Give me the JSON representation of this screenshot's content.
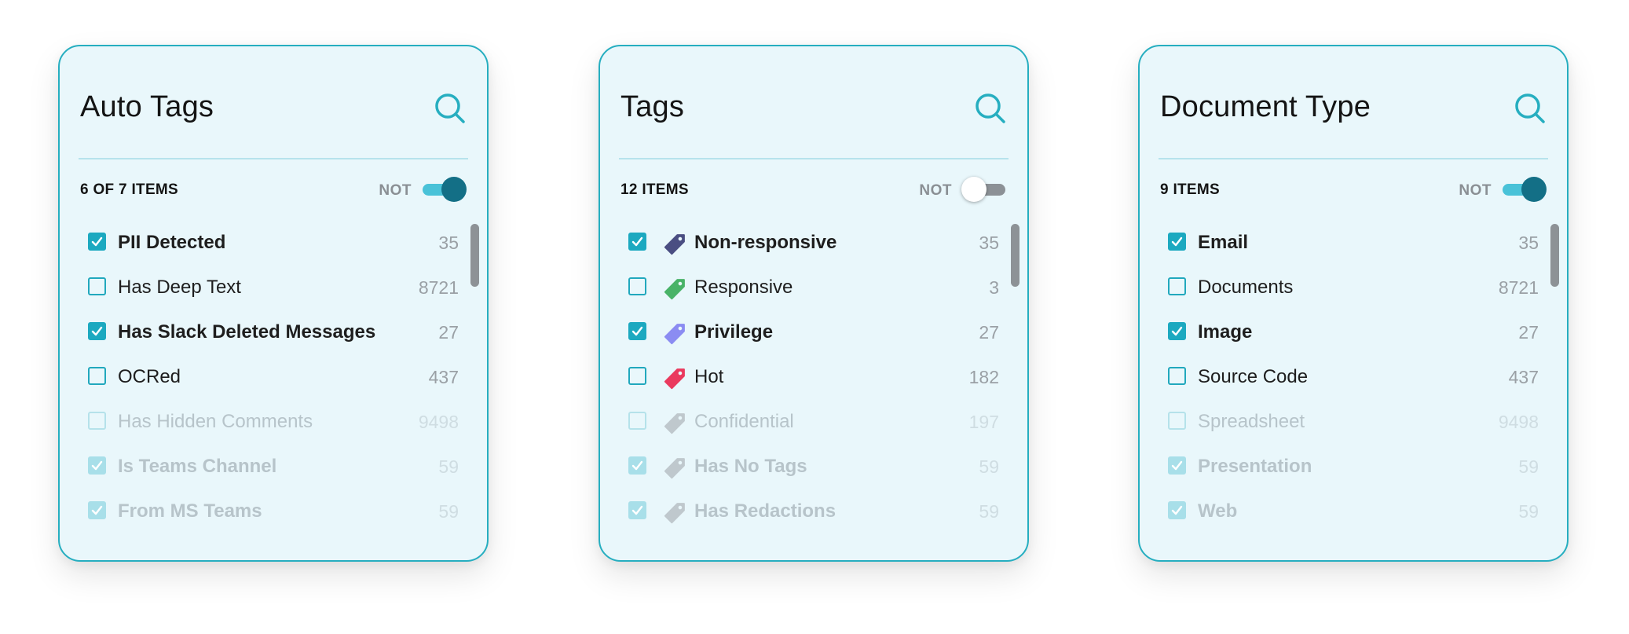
{
  "panels": [
    {
      "title": "Auto Tags",
      "count_label": "6 OF 7 ITEMS",
      "not_label": "NOT",
      "not_enabled": true,
      "items": [
        {
          "label": "PII Detected",
          "count": "35",
          "checked": true,
          "bold": true,
          "faded": false
        },
        {
          "label": "Has Deep Text",
          "count": "8721",
          "checked": false,
          "bold": false,
          "faded": false
        },
        {
          "label": "Has Slack Deleted Messages",
          "count": "27",
          "checked": true,
          "bold": true,
          "faded": false
        },
        {
          "label": "OCRed",
          "count": "437",
          "checked": false,
          "bold": false,
          "faded": false
        },
        {
          "label": "Has Hidden Comments",
          "count": "9498",
          "checked": false,
          "bold": false,
          "faded": true
        },
        {
          "label": "Is Teams Channel",
          "count": "59",
          "checked": true,
          "bold": true,
          "faded": true
        },
        {
          "label": "From MS Teams",
          "count": "59",
          "checked": true,
          "bold": true,
          "faded": true
        }
      ]
    },
    {
      "title": "Tags",
      "count_label": "12 ITEMS",
      "not_label": "NOT",
      "not_enabled": false,
      "items": [
        {
          "label": "Non-responsive",
          "count": "35",
          "checked": true,
          "bold": true,
          "faded": false,
          "tag_color": "#4a4e82"
        },
        {
          "label": "Responsive",
          "count": "3",
          "checked": false,
          "bold": false,
          "faded": false,
          "tag_color": "#49b368"
        },
        {
          "label": "Privilege",
          "count": "27",
          "checked": true,
          "bold": true,
          "faded": false,
          "tag_color": "#8b8cf2"
        },
        {
          "label": "Hot",
          "count": "182",
          "checked": false,
          "bold": false,
          "faded": false,
          "tag_color": "#ea3a5e"
        },
        {
          "label": "Confidential",
          "count": "197",
          "checked": false,
          "bold": false,
          "faded": true,
          "tag_color": "#9ea3a8"
        },
        {
          "label": "Has No Tags",
          "count": "59",
          "checked": true,
          "bold": true,
          "faded": true,
          "tag_color": "#9ea3a8"
        },
        {
          "label": "Has Redactions",
          "count": "59",
          "checked": true,
          "bold": true,
          "faded": true,
          "tag_color": "#9ea3a8"
        }
      ]
    },
    {
      "title": "Document Type",
      "count_label": "9 ITEMS",
      "not_label": "NOT",
      "not_enabled": true,
      "items": [
        {
          "label": "Email",
          "count": "35",
          "checked": true,
          "bold": true,
          "faded": false
        },
        {
          "label": "Documents",
          "count": "8721",
          "checked": false,
          "bold": false,
          "faded": false
        },
        {
          "label": "Image",
          "count": "27",
          "checked": true,
          "bold": true,
          "faded": false
        },
        {
          "label": "Source Code",
          "count": "437",
          "checked": false,
          "bold": false,
          "faded": false
        },
        {
          "label": "Spreadsheet",
          "count": "9498",
          "checked": false,
          "bold": false,
          "faded": true
        },
        {
          "label": "Presentation",
          "count": "59",
          "checked": true,
          "bold": true,
          "faded": true
        },
        {
          "label": "Web",
          "count": "59",
          "checked": true,
          "bold": true,
          "faded": true
        }
      ]
    }
  ],
  "icons": {
    "search": "search-icon",
    "tag": "tag-icon",
    "check": "check-icon"
  },
  "colors": {
    "accent": "#26aec0",
    "panel_bg": "#e9f7fb",
    "toggle_on": "#136f86"
  }
}
